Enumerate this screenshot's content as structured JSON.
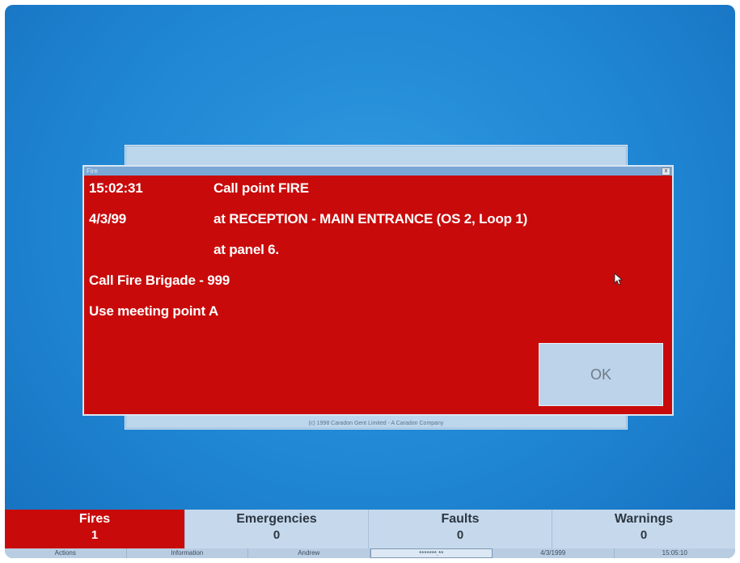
{
  "alarm": {
    "window_title": "Fire",
    "close_glyph": "x",
    "time": "15:02:31",
    "date": "4/3/99",
    "line1": "Call point FIRE",
    "line2": "at RECEPTION - MAIN ENTRANCE (OS 2, Loop 1)",
    "line3": "at panel 6.",
    "line4": "Call Fire Brigade - 999",
    "line5": "Use meeting point A",
    "ok_label": "OK",
    "color": "#c90a0a"
  },
  "copyright": "(c) 1998 Caradon Gent Limited - A Caradon Company",
  "status": [
    {
      "name": "Fires",
      "count": "1"
    },
    {
      "name": "Emergencies",
      "count": "0"
    },
    {
      "name": "Faults",
      "count": "0"
    },
    {
      "name": "Warnings",
      "count": "0"
    }
  ],
  "nav": {
    "actions": "Actions",
    "information": "Information",
    "user": "Andrew",
    "password": "*******.**",
    "date": "4/3/1999",
    "time": "15:05:10"
  }
}
